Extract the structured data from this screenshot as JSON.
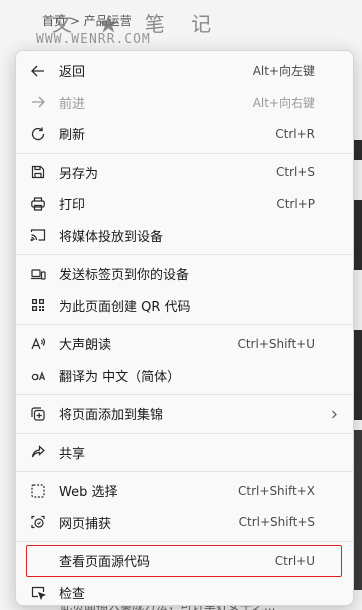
{
  "background": {
    "breadcrumb": "首页 > 产品运营",
    "watermark_cn": "文 ★ 笔 记",
    "watermark_url": "WWW.WENRR.COM",
    "bottom_text": "此页面插入集成方法，可订单好女子之..."
  },
  "menu": {
    "items": [
      {
        "icon": "arrow-left-icon",
        "label": "返回",
        "shortcut": "Alt+向左键",
        "disabled": false
      },
      {
        "icon": "arrow-right-icon",
        "label": "前进",
        "shortcut": "Alt+向右键",
        "disabled": true
      },
      {
        "icon": "refresh-icon",
        "label": "刷新",
        "shortcut": "Ctrl+R",
        "disabled": false
      },
      {
        "separator": true
      },
      {
        "icon": "save-as-icon",
        "label": "另存为",
        "shortcut": "Ctrl+S",
        "disabled": false
      },
      {
        "icon": "print-icon",
        "label": "打印",
        "shortcut": "Ctrl+P",
        "disabled": false
      },
      {
        "icon": "cast-icon",
        "label": "将媒体投放到设备",
        "shortcut": "",
        "disabled": false
      },
      {
        "separator": true
      },
      {
        "icon": "send-to-device-icon",
        "label": "发送标签页到你的设备",
        "shortcut": "",
        "disabled": false
      },
      {
        "icon": "qr-code-icon",
        "label": "为此页面创建 QR 代码",
        "shortcut": "",
        "disabled": false
      },
      {
        "separator": true
      },
      {
        "icon": "read-aloud-icon",
        "label": "大声朗读",
        "shortcut": "Ctrl+Shift+U",
        "disabled": false
      },
      {
        "icon": "translate-icon",
        "label": "翻译为 中文（简体）",
        "shortcut": "",
        "disabled": false
      },
      {
        "separator": true
      },
      {
        "icon": "collections-icon",
        "label": "将页面添加到集锦",
        "shortcut": "",
        "disabled": false,
        "submenu": true
      },
      {
        "separator": true
      },
      {
        "icon": "share-icon",
        "label": "共享",
        "shortcut": "",
        "disabled": false
      },
      {
        "separator": true
      },
      {
        "icon": "web-select-icon",
        "label": "Web 选择",
        "shortcut": "Ctrl+Shift+X",
        "disabled": false
      },
      {
        "icon": "web-capture-icon",
        "label": "网页捕获",
        "shortcut": "Ctrl+Shift+S",
        "disabled": false
      },
      {
        "separator": true
      },
      {
        "icon": "",
        "label": "查看页面源代码",
        "shortcut": "Ctrl+U",
        "disabled": false,
        "highlight": true
      },
      {
        "icon": "inspect-icon",
        "label": "检查",
        "shortcut": "",
        "disabled": false
      }
    ]
  },
  "colors": {
    "highlight_border": "#e02020",
    "menu_bg": "#f9f9f9",
    "disabled_text": "#9a9a9a"
  }
}
